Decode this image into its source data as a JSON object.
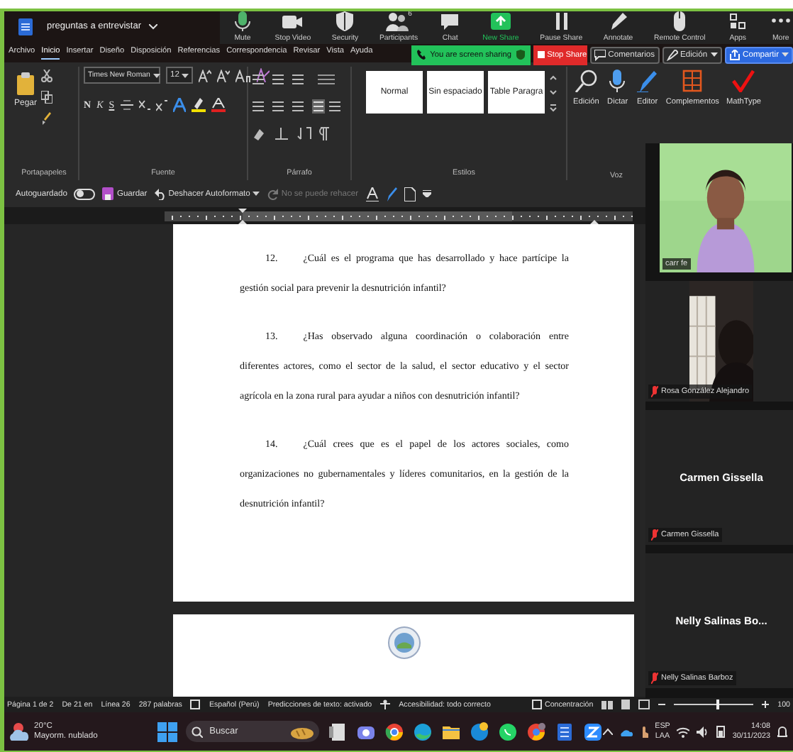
{
  "window": {
    "title": "preguntas a entrevistar"
  },
  "zoom_toolbar": {
    "buttons": [
      {
        "kind": "mic",
        "label": "Mute"
      },
      {
        "kind": "video",
        "label": "Stop Video"
      },
      {
        "kind": "shield",
        "label": "Security"
      },
      {
        "kind": "people",
        "label": "Participants",
        "badge": "6"
      },
      {
        "kind": "chat",
        "label": "Chat"
      },
      {
        "kind": "share",
        "label": "New Share"
      },
      {
        "kind": "pause",
        "label": "Pause Share"
      },
      {
        "kind": "pen",
        "label": "Annotate"
      },
      {
        "kind": "mouse",
        "label": "Remote Control"
      },
      {
        "kind": "apps",
        "label": "Apps"
      },
      {
        "kind": "more",
        "label": "More"
      }
    ],
    "banner": "You are screen sharing",
    "stop": "Stop Share"
  },
  "menu": {
    "items": [
      {
        "label": "Archivo",
        "selected": false
      },
      {
        "label": "Inicio",
        "selected": true
      },
      {
        "label": "Insertar",
        "selected": false
      },
      {
        "label": "Diseño",
        "selected": false
      },
      {
        "label": "Disposición",
        "selected": false
      },
      {
        "label": "Referencias",
        "selected": false
      },
      {
        "label": "Correspondencia",
        "selected": false
      },
      {
        "label": "Revisar",
        "selected": false
      },
      {
        "label": "Vista",
        "selected": false
      },
      {
        "label": "Ayuda",
        "selected": false
      }
    ],
    "actions": [
      {
        "kind": "comment",
        "label": "Comentarios"
      },
      {
        "kind": "edit",
        "label": "Edición"
      },
      {
        "kind": "share",
        "label": "Compartir"
      }
    ]
  },
  "ribbon": {
    "paste": "Pegar",
    "font": "Times New Roman",
    "size": "12",
    "format": [
      "N",
      "K",
      "S"
    ],
    "styles": [
      "Normal",
      "Sin espaciado",
      "Table Paragra"
    ],
    "tools": [
      {
        "kind": "search",
        "label": "Edición"
      },
      {
        "kind": "mic",
        "label": "Dictar"
      },
      {
        "kind": "pen",
        "label": "Editor"
      },
      {
        "kind": "grid",
        "label": "Complementos"
      },
      {
        "kind": "check",
        "label": "MathType"
      }
    ],
    "groups": [
      "Portapapeles",
      "Fuente",
      "Párrafo",
      "Estilos",
      "Voz"
    ]
  },
  "quick_access": {
    "autosave": {
      "label": "Autoguardado",
      "on": false
    },
    "save": "Guardar",
    "undo": "Deshacer Autoformato",
    "redo": {
      "label": "No se puede rehacer",
      "disabled": true
    }
  },
  "document": {
    "paragraphs": [
      {
        "number": "12.",
        "text": "¿Cuál es el programa que has desarrollado y hace partícipe la gestión social para prevenir la desnutrición infantil?"
      },
      {
        "number": "13.",
        "text": "¿Has observado alguna coordinación o colaboración entre diferentes actores, como el sector de la salud, el sector educativo y el sector agrícola en la zona rural para ayudar a niños con desnutrición infantil?"
      },
      {
        "number": "14.",
        "text": "¿Cuál crees que es el papel de los actores sociales, como organizaciones no gubernamentales y líderes comunitarios, en la gestión de la desnutrición infantil?"
      }
    ]
  },
  "participants": [
    {
      "kind": "camera",
      "label": "carr fe",
      "muted": false
    },
    {
      "kind": "camera",
      "label": "Rosa González Alejandro",
      "muted": true
    },
    {
      "kind": "name",
      "name": "Carmen Gissella",
      "label": "Carmen Gissella",
      "muted": true
    },
    {
      "kind": "name",
      "name": "Nelly Salinas Bo...",
      "label": "Nelly Salinas Barboz",
      "muted": true
    }
  ],
  "status_bar": {
    "items": [
      "Página 1 de 2",
      "De 21 en",
      "Línea 26",
      "287 palabras",
      "Español (Perú)",
      "Predicciones de texto: activado",
      "Accesibilidad: todo correcto"
    ],
    "focus": "Concentración",
    "zoom": {
      "level": 0.55,
      "reading": "100"
    }
  },
  "taskbar": {
    "weather": {
      "temp": "20°C",
      "text": "Mayorm. nublado"
    },
    "search": "Buscar",
    "language": [
      "ESP",
      "LAA"
    ],
    "time": "14:08",
    "date": "30/11/2023"
  }
}
